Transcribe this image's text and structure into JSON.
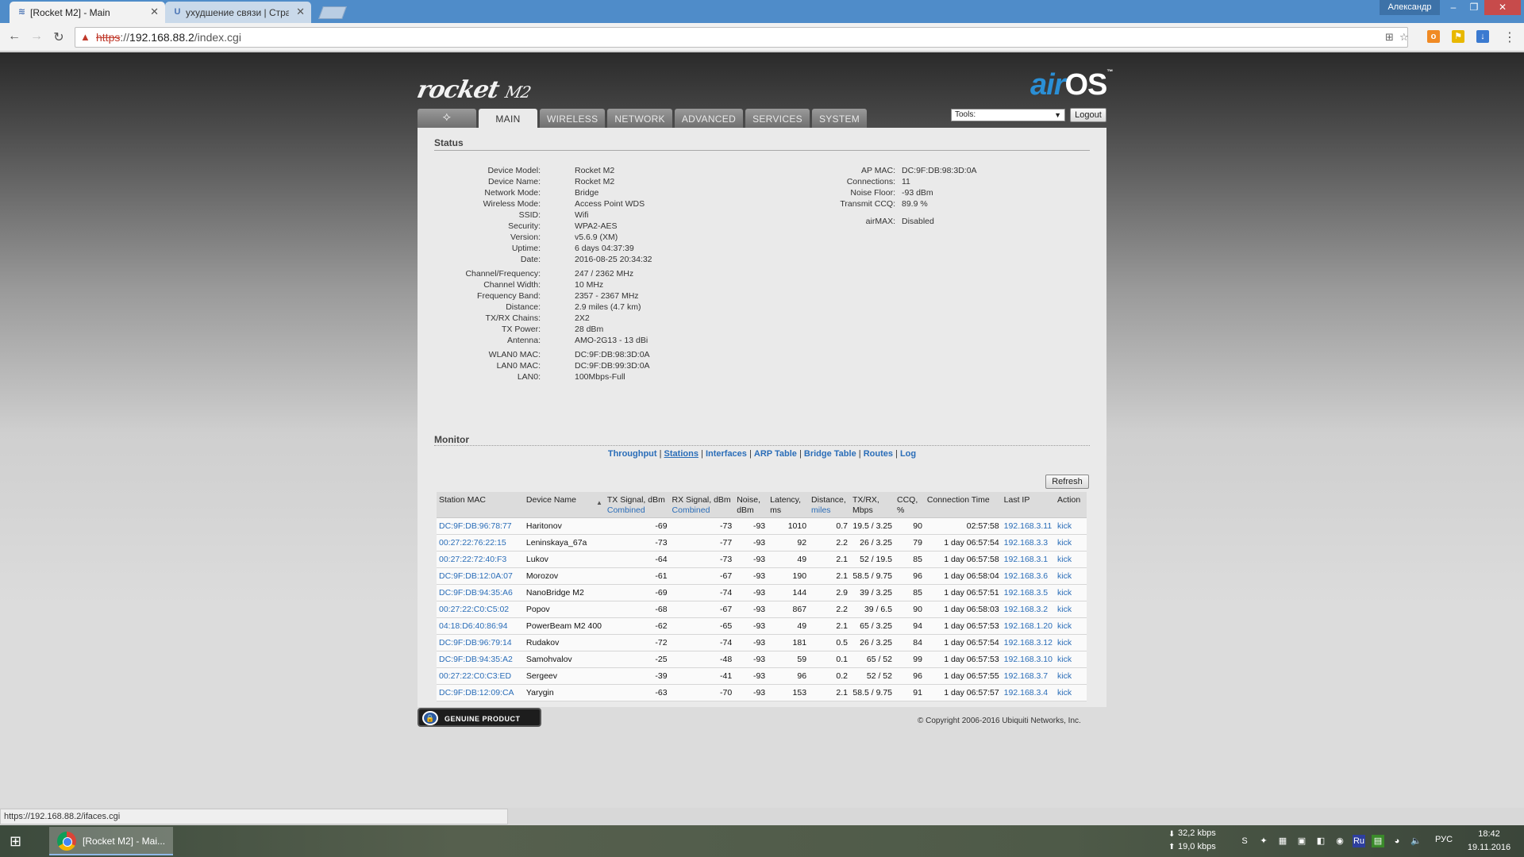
{
  "browser": {
    "tabs": [
      {
        "title": "[Rocket M2] - Main",
        "active": true
      },
      {
        "title": "ухудшение связи | Стра",
        "active": false
      }
    ],
    "user": "Александр",
    "url_scheme": "https",
    "url_host": "192.168.88.2",
    "url_path": "/index.cgi",
    "status_url": "https://192.168.88.2/ifaces.cgi"
  },
  "header": {
    "product": "rocket",
    "model": "M2",
    "airos_air": "air",
    "airos_os": "OS",
    "airos_tm": "™",
    "nav": [
      "MAIN",
      "WIRELESS",
      "NETWORK",
      "ADVANCED",
      "SERVICES",
      "SYSTEM"
    ],
    "active_nav": "MAIN",
    "tools_label": "Tools:",
    "logout_label": "Logout"
  },
  "status": {
    "title": "Status",
    "left": [
      {
        "k": "Device Model:",
        "v": "Rocket M2"
      },
      {
        "k": "Device Name:",
        "v": "Rocket M2"
      },
      {
        "k": "Network Mode:",
        "v": "Bridge"
      },
      {
        "k": "Wireless Mode:",
        "v": "Access Point WDS"
      },
      {
        "k": "SSID:",
        "v": "Wifi"
      },
      {
        "k": "Security:",
        "v": "WPA2-AES"
      },
      {
        "k": "Version:",
        "v": "v5.6.9 (XM)"
      },
      {
        "k": "Uptime:",
        "v": "6 days 04:37:39"
      },
      {
        "k": "Date:",
        "v": "2016-08-25 20:34:32"
      },
      {
        "k": "Channel/Frequency:",
        "v": "247 / 2362 MHz"
      },
      {
        "k": "Channel Width:",
        "v": "10 MHz"
      },
      {
        "k": "Frequency Band:",
        "v": "2357 - 2367 MHz"
      },
      {
        "k": "Distance:",
        "v": "2.9 miles (4.7 km)"
      },
      {
        "k": "TX/RX Chains:",
        "v": "2X2"
      },
      {
        "k": "TX Power:",
        "v": "28 dBm"
      },
      {
        "k": "Antenna:",
        "v": "AMO-2G13 - 13 dBi"
      },
      {
        "k": "WLAN0 MAC:",
        "v": "DC:9F:DB:98:3D:0A"
      },
      {
        "k": "LAN0 MAC:",
        "v": "DC:9F:DB:99:3D:0A"
      },
      {
        "k": "LAN0:",
        "v": "100Mbps-Full"
      }
    ],
    "right": [
      {
        "k": "AP MAC:",
        "v": "DC:9F:DB:98:3D:0A"
      },
      {
        "k": "Connections:",
        "v": "11"
      },
      {
        "k": "Noise Floor:",
        "v": "-93 dBm"
      },
      {
        "k": "Transmit CCQ:",
        "v": "89.9 %"
      },
      {
        "k": "airMAX:",
        "v": "Disabled"
      }
    ]
  },
  "monitor": {
    "title": "Monitor",
    "links": [
      "Throughput",
      "Stations",
      "Interfaces",
      "ARP Table",
      "Bridge Table",
      "Routes",
      "Log"
    ],
    "current_link": "Stations",
    "refresh_label": "Refresh",
    "columns": [
      {
        "label": "Station MAC",
        "sub": ""
      },
      {
        "label": "Device Name",
        "sub": ""
      },
      {
        "label": "TX Signal, dBm",
        "sub": "Combined"
      },
      {
        "label": "RX Signal, dBm",
        "sub": "Combined"
      },
      {
        "label": "Noise, dBm",
        "sub": ""
      },
      {
        "label": "Latency, ms",
        "sub": ""
      },
      {
        "label": "Distance,",
        "sub": "miles"
      },
      {
        "label": "TX/RX, Mbps",
        "sub": ""
      },
      {
        "label": "CCQ, %",
        "sub": ""
      },
      {
        "label": "Connection Time",
        "sub": ""
      },
      {
        "label": "Last IP",
        "sub": ""
      },
      {
        "label": "Action",
        "sub": ""
      }
    ],
    "rows": [
      [
        "DC:9F:DB:96:78:77",
        "Haritonov",
        "-69",
        "-73",
        "-93",
        "1010",
        "0.7",
        "19.5 / 3.25",
        "90",
        "02:57:58",
        "192.168.3.11",
        "kick"
      ],
      [
        "00:27:22:76:22:15",
        "Leninskaya_67a",
        "-73",
        "-77",
        "-93",
        "92",
        "2.2",
        "26 / 3.25",
        "79",
        "1 day 06:57:54",
        "192.168.3.3",
        "kick"
      ],
      [
        "00:27:22:72:40:F3",
        "Lukov",
        "-64",
        "-73",
        "-93",
        "49",
        "2.1",
        "52 / 19.5",
        "85",
        "1 day 06:57:58",
        "192.168.3.1",
        "kick"
      ],
      [
        "DC:9F:DB:12:0A:07",
        "Morozov",
        "-61",
        "-67",
        "-93",
        "190",
        "2.1",
        "58.5 / 9.75",
        "96",
        "1 day 06:58:04",
        "192.168.3.6",
        "kick"
      ],
      [
        "DC:9F:DB:94:35:A6",
        "NanoBridge M2",
        "-69",
        "-74",
        "-93",
        "144",
        "2.9",
        "39 / 3.25",
        "85",
        "1 day 06:57:51",
        "192.168.3.5",
        "kick"
      ],
      [
        "00:27:22:C0:C5:02",
        "Popov",
        "-68",
        "-67",
        "-93",
        "867",
        "2.2",
        "39 / 6.5",
        "90",
        "1 day 06:58:03",
        "192.168.3.2",
        "kick"
      ],
      [
        "04:18:D6:40:86:94",
        "PowerBeam M2 400",
        "-62",
        "-65",
        "-93",
        "49",
        "2.1",
        "65 / 3.25",
        "94",
        "1 day 06:57:53",
        "192.168.1.20",
        "kick"
      ],
      [
        "DC:9F:DB:96:79:14",
        "Rudakov",
        "-72",
        "-74",
        "-93",
        "181",
        "0.5",
        "26 / 3.25",
        "84",
        "1 day 06:57:54",
        "192.168.3.12",
        "kick"
      ],
      [
        "DC:9F:DB:94:35:A2",
        "Samohvalov",
        "-25",
        "-48",
        "-93",
        "59",
        "0.1",
        "65 / 52",
        "99",
        "1 day 06:57:53",
        "192.168.3.10",
        "kick"
      ],
      [
        "00:27:22:C0:C3:ED",
        "Sergeev",
        "-39",
        "-41",
        "-93",
        "96",
        "0.2",
        "52 / 52",
        "96",
        "1 day 06:57:55",
        "192.168.3.7",
        "kick"
      ],
      [
        "DC:9F:DB:12:09:CA",
        "Yarygin",
        "-63",
        "-70",
        "-93",
        "153",
        "2.1",
        "58.5 / 9.75",
        "91",
        "1 day 06:57:57",
        "192.168.3.4",
        "kick"
      ]
    ]
  },
  "footer": {
    "genuine_label": "GENUINE PRODUCT",
    "copyright": "© Copyright 2006-2016 Ubiquiti Networks, Inc."
  },
  "taskbar": {
    "task_title": "[Rocket M2] - Mai...",
    "net_down": "32,2 kbps",
    "net_up": "19,0 kbps",
    "lang": "РУС",
    "time": "18:42",
    "date": "19.11.2016"
  }
}
